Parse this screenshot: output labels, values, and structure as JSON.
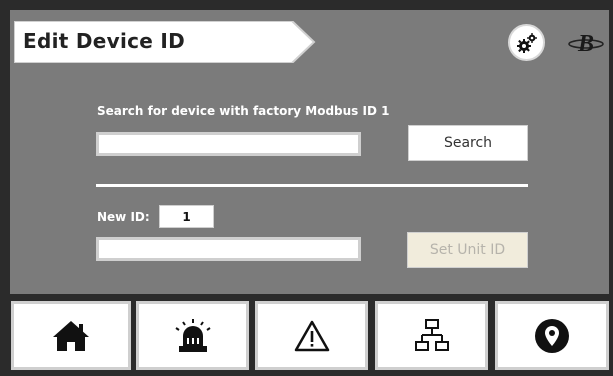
{
  "header": {
    "title": "Edit Device ID",
    "settings_icon": "gears-icon",
    "logo_icon": "brand-logo"
  },
  "search": {
    "label": "Search for device with factory Modbus ID 1",
    "input_value": "",
    "button_label": "Search"
  },
  "set_id": {
    "label": "New ID:",
    "new_id_value": "1",
    "input_value": "",
    "button_label": "Set Unit ID",
    "button_disabled": true
  },
  "nav": {
    "items": [
      {
        "icon": "home-icon"
      },
      {
        "icon": "alarm-icon"
      },
      {
        "icon": "warning-icon"
      },
      {
        "icon": "network-icon"
      },
      {
        "icon": "location-pin-icon"
      }
    ]
  },
  "colors": {
    "panel": "#7b7b7b",
    "frame": "#2b2b2b",
    "disabled_button": "#f1ecdc"
  }
}
